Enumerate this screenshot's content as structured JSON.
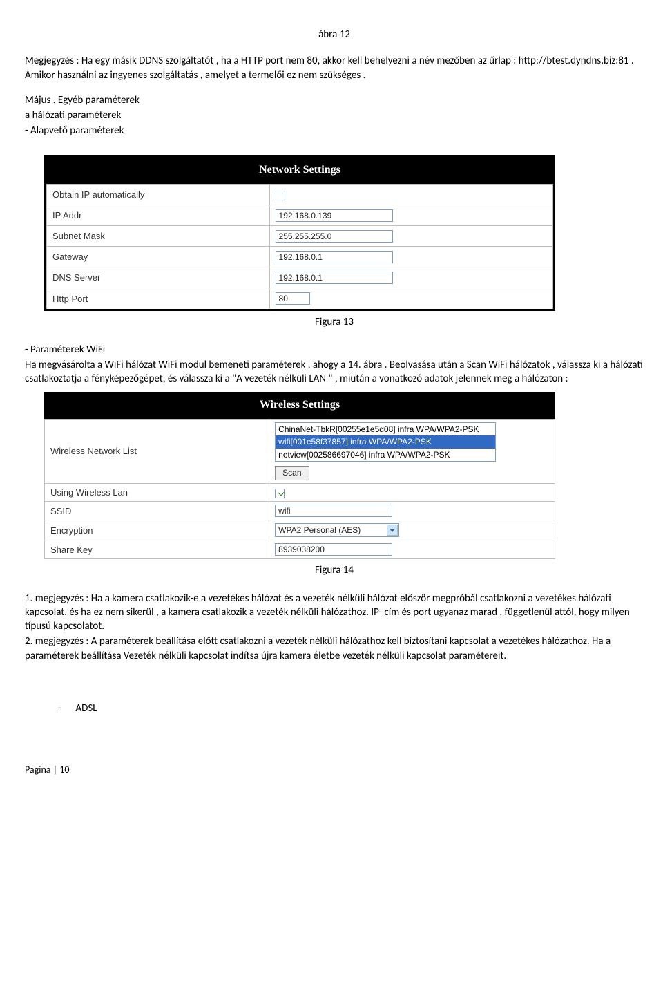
{
  "top_caption": "ábra 12",
  "para1": "Megjegyzés : Ha egy másik DDNS szolgáltatót , ha a HTTP port nem 80, akkor kell behelyezni a név mezőben az űrlap : http://btest.dyndns.biz:81 . Amikor használni az ingyenes szolgáltatás , amelyet a termelői ez nem szükséges .",
  "para2_lines": {
    "l1": "Május . Egyéb paraméterek",
    "l2": "a hálózati paraméterek",
    "l3": "- Alapvető paraméterek"
  },
  "fig13": {
    "title": "Network Settings",
    "rows": [
      {
        "label": "Obtain IP automatically",
        "type": "checkbox",
        "value": ""
      },
      {
        "label": "IP Addr",
        "type": "input",
        "value": "192.168.0.139"
      },
      {
        "label": "Subnet Mask",
        "type": "input",
        "value": "255.255.255.0"
      },
      {
        "label": "Gateway",
        "type": "input",
        "value": "192.168.0.1"
      },
      {
        "label": "DNS Server",
        "type": "input",
        "value": "192.168.0.1"
      },
      {
        "label": "Http Port",
        "type": "input",
        "value": "80"
      }
    ],
    "caption": "Figura 13"
  },
  "para3_lines": {
    "l1": "- Paraméterek WiFi",
    "l2": "Ha megvásárolta a WiFi hálózat WiFi modul bemeneti paraméterek , ahogy a 14. ábra . Beolvasása után a Scan WiFi hálózatok , válassza ki a hálózati csatlakoztatja a fényképezőgépet, és válassza ki a \"A vezeték nélküli LAN \" , miután a vonatkozó adatok jelennek meg a hálózaton :"
  },
  "fig14": {
    "title": "Wireless Settings",
    "list_label": "Wireless Network List",
    "options": [
      {
        "text": "ChinaNet-TbkR[00255e1e5d08] infra WPA/WPA2-PSK",
        "selected": false
      },
      {
        "text": "wifi[001e58f37857] infra WPA/WPA2-PSK",
        "selected": true
      },
      {
        "text": "netview[002586697046] infra WPA/WPA2-PSK",
        "selected": false
      }
    ],
    "scan_btn": "Scan",
    "rows": {
      "using_label": "Using Wireless Lan",
      "ssid_label": "SSID",
      "ssid_value": "wifi",
      "enc_label": "Encryption",
      "enc_value": "WPA2 Personal (AES)",
      "key_label": "Share Key",
      "key_value": "8939038200"
    },
    "caption": "Figura 14"
  },
  "para4": "1. megjegyzés : Ha a kamera csatlakozik-e a vezetékes hálózat és a vezeték nélküli hálózat először megpróbál csatlakozni a vezetékes hálózati kapcsolat, és ha ez nem sikerül , a kamera csatlakozik a vezeték nélküli hálózathoz. IP- cím és port ugyanaz marad , függetlenül attól, hogy milyen típusú kapcsolatot.",
  "para5": "2. megjegyzés : A paraméterek beállítása előtt csatlakozni a vezeték nélküli hálózathoz kell biztosítani kapcsolat a vezetékes hálózathoz. Ha a paraméterek beállítása Vezeték nélküli kapcsolat indítsa újra kamera életbe vezeték nélküli kapcsolat paramétereit.",
  "adsl_dash": "-",
  "adsl_label": "ADSL",
  "footer": "Pagina | 10"
}
